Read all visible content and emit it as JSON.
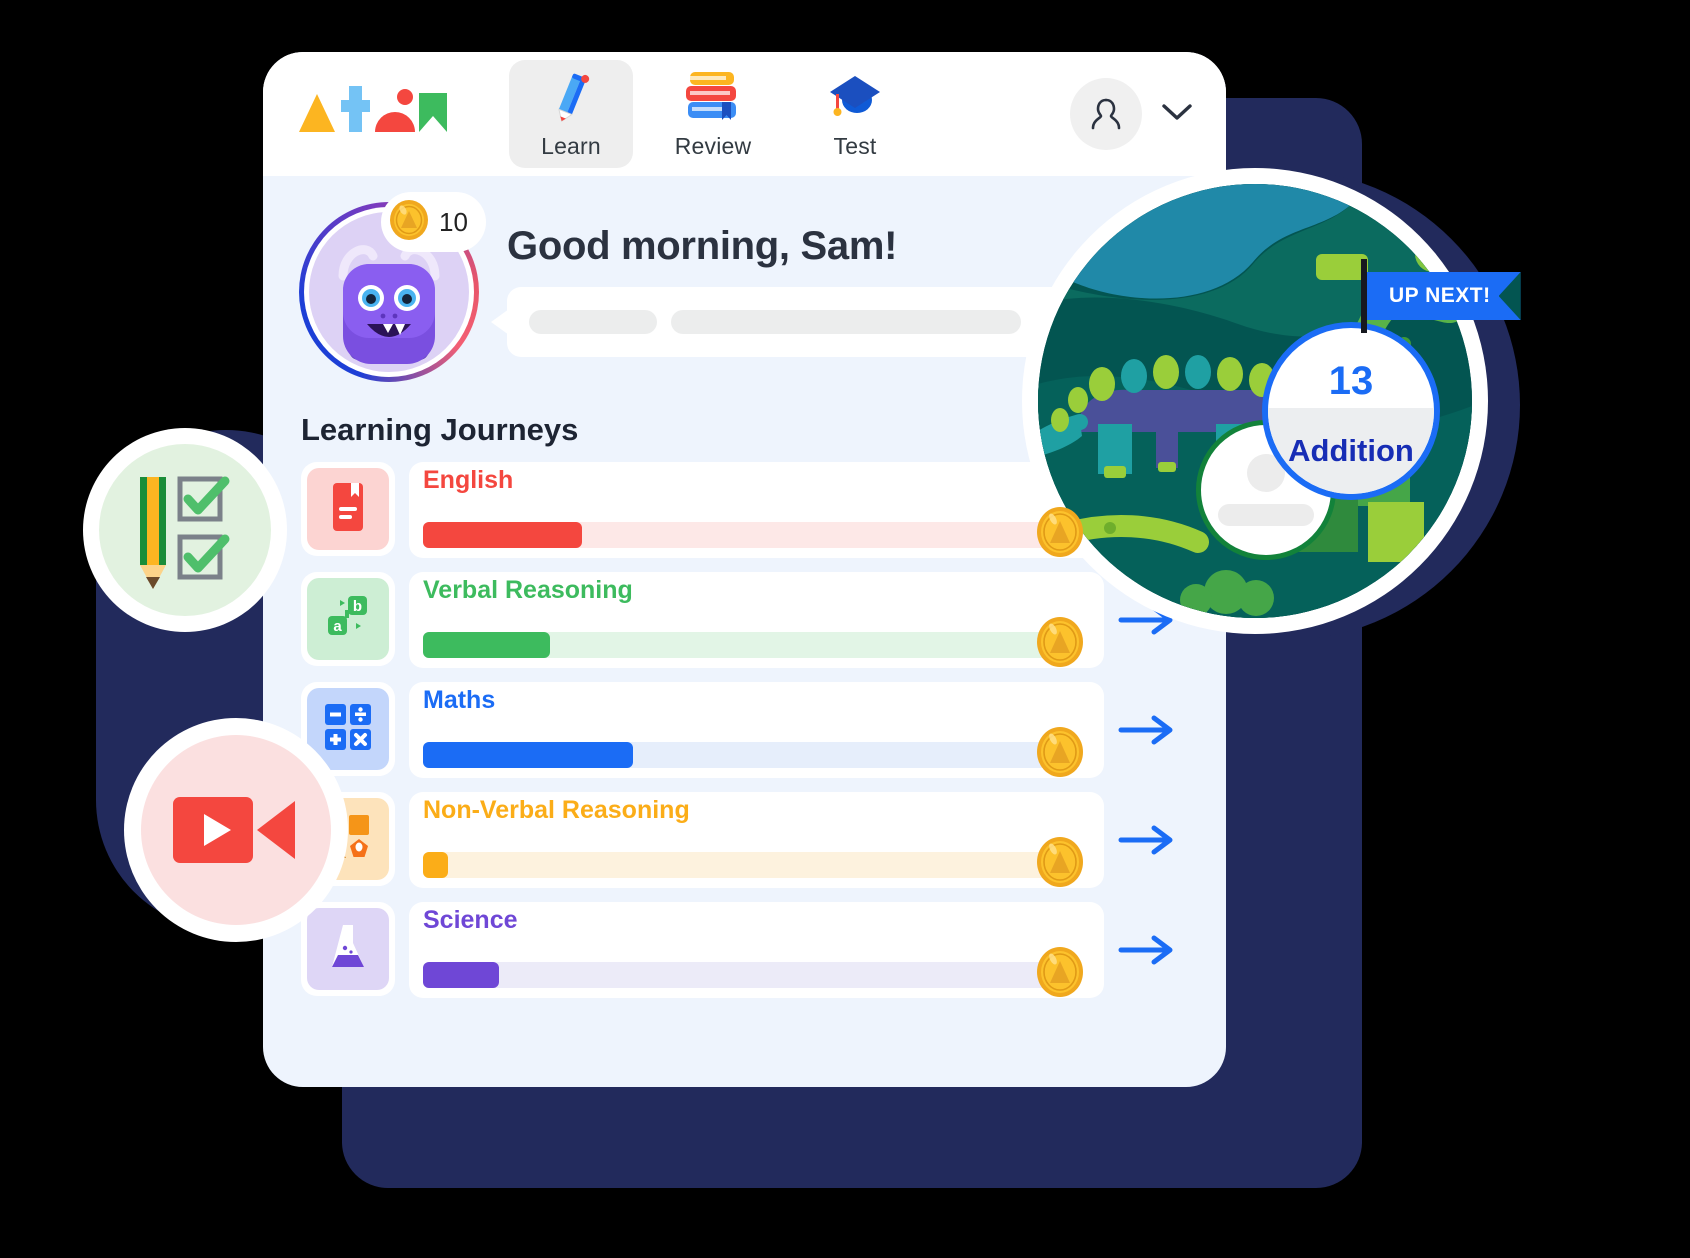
{
  "brand": {
    "logo_name": "atom-logo",
    "logo_alt": "Atom"
  },
  "header": {
    "nav": [
      {
        "label": "Learn",
        "icon": "pencil-icon",
        "active": true
      },
      {
        "label": "Review",
        "icon": "stacked-books-icon",
        "active": false
      },
      {
        "label": "Test",
        "icon": "graduation-cap-icon",
        "active": false
      }
    ],
    "account": {
      "icon": "user-avatar-icon",
      "chevron": "chevron-down-icon"
    }
  },
  "greeting": {
    "title": "Good morning, Sam!",
    "coins": "10",
    "coin_icon": "coin-icon",
    "avatar": "monster-avatar"
  },
  "journeys": {
    "section_title": "Learning Journeys",
    "rows": [
      {
        "name": "English",
        "icon": "book-icon",
        "color": "#f4473f",
        "track": "#fde8e7",
        "tile": "#fcd4d2",
        "progress": 25,
        "coin": "coin-icon",
        "arrow": "arrow-right-icon",
        "show_arrow": false
      },
      {
        "name": "Verbal Reasoning",
        "icon": "letter-tiles-icon",
        "color": "#3dbb5e",
        "track": "#e2f5e6",
        "tile": "#cdeed4",
        "progress": 20,
        "coin": "coin-icon",
        "arrow": "arrow-right-icon",
        "show_arrow": true
      },
      {
        "name": "Maths",
        "icon": "calculator-icon",
        "color": "#1b6cf5",
        "track": "#e6eefb",
        "tile": "#c3d6fb",
        "progress": 33,
        "coin": "coin-icon",
        "arrow": "arrow-right-icon",
        "show_arrow": true
      },
      {
        "name": "Non-Verbal Reasoning",
        "icon": "shapes-icon",
        "color": "#fbad18",
        "track": "#fdf2de",
        "tile": "#fde3bb",
        "progress": 4,
        "coin": "coin-icon",
        "arrow": "arrow-right-icon",
        "show_arrow": true
      },
      {
        "name": "Science",
        "icon": "flask-icon",
        "color": "#6f47d6",
        "track": "#ecebf8",
        "tile": "#ded6f6",
        "progress": 12,
        "coin": "coin-icon",
        "arrow": "arrow-right-icon",
        "show_arrow": true
      }
    ]
  },
  "floating": {
    "pencil_badge": {
      "icon": "pencil-and-checkboxes-icon"
    },
    "video_badge": {
      "icon": "video-camera-icon"
    }
  },
  "up_next": {
    "banner": "UP NEXT!",
    "lesson_number": "13",
    "lesson_name": "Addition",
    "scene": "dinosaur-map-scene"
  },
  "colors": {
    "brand_blue": "#1b6cf5",
    "card_bg": "#eef4fd",
    "navy_shadow": "#222a5c",
    "dino_bg": "#035551"
  }
}
